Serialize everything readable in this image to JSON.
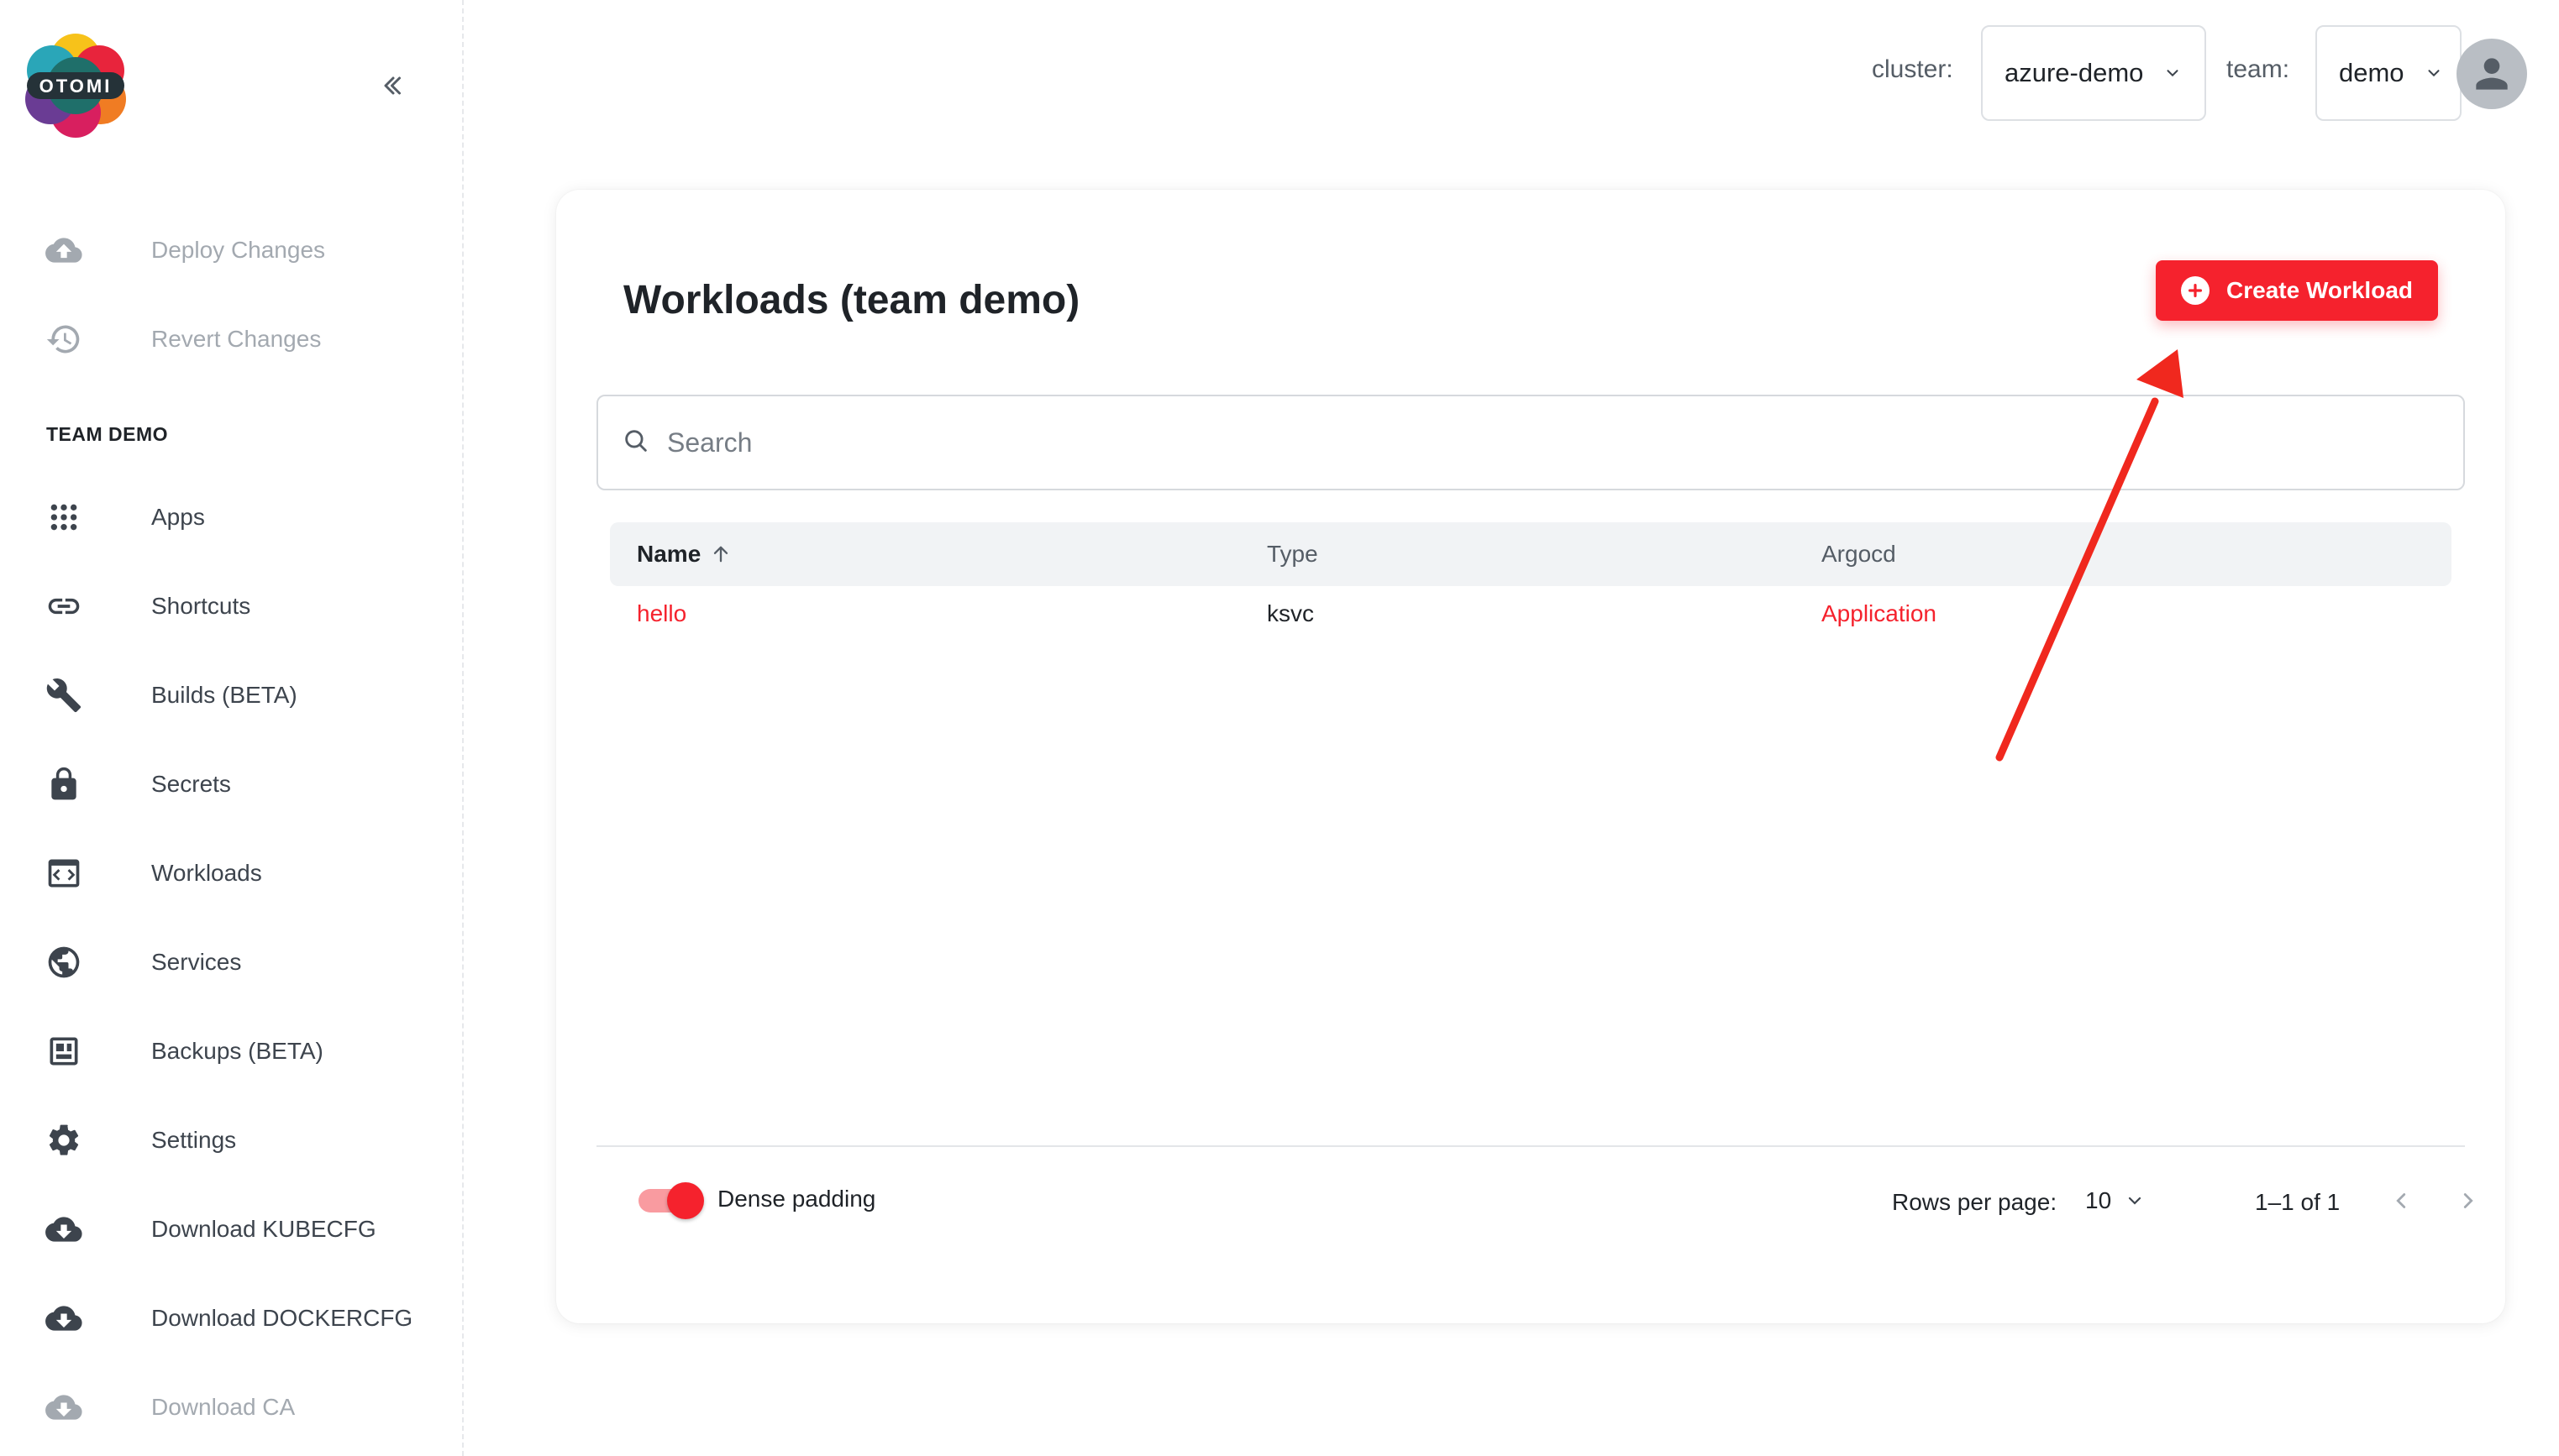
{
  "brand": {
    "logo_text": "OTOMI"
  },
  "sidebar": {
    "actions": [
      {
        "label": "Deploy Changes",
        "icon": "cloud-upload-icon",
        "disabled": true
      },
      {
        "label": "Revert Changes",
        "icon": "history-icon",
        "disabled": true
      }
    ],
    "section_title": "TEAM DEMO",
    "items": [
      {
        "label": "Apps",
        "icon": "apps-grid-icon"
      },
      {
        "label": "Shortcuts",
        "icon": "link-icon"
      },
      {
        "label": "Builds (BETA)",
        "icon": "wrench-icon"
      },
      {
        "label": "Secrets",
        "icon": "lock-icon"
      },
      {
        "label": "Workloads",
        "icon": "workloads-icon"
      },
      {
        "label": "Services",
        "icon": "globe-icon"
      },
      {
        "label": "Backups (BETA)",
        "icon": "backup-icon"
      },
      {
        "label": "Settings",
        "icon": "gear-icon"
      },
      {
        "label": "Download KUBECFG",
        "icon": "cloud-download-icon"
      },
      {
        "label": "Download DOCKERCFG",
        "icon": "cloud-download-icon"
      },
      {
        "label": "Download CA",
        "icon": "cloud-download-icon",
        "disabled": true
      }
    ]
  },
  "header": {
    "cluster_label": "cluster:",
    "cluster_value": "azure-demo",
    "team_label": "team:",
    "team_value": "demo"
  },
  "main": {
    "title": "Workloads (team demo)",
    "create_button": "Create Workload",
    "search_placeholder": "Search",
    "columns": [
      "Name",
      "Type",
      "Argocd"
    ],
    "rows": [
      {
        "name": "hello",
        "type": "ksvc",
        "argocd": "Application"
      }
    ],
    "footer": {
      "dense_padding_label": "Dense padding",
      "dense_padding_on": true,
      "rows_per_page_label": "Rows per page:",
      "rows_per_page_value": "10",
      "range_text": "1–1 of 1"
    }
  },
  "colors": {
    "accent": "#f5222d",
    "annotation_arrow": "#f0281e",
    "sidebar_icon": "#3d444d",
    "disabled": "#a3a9b0"
  }
}
